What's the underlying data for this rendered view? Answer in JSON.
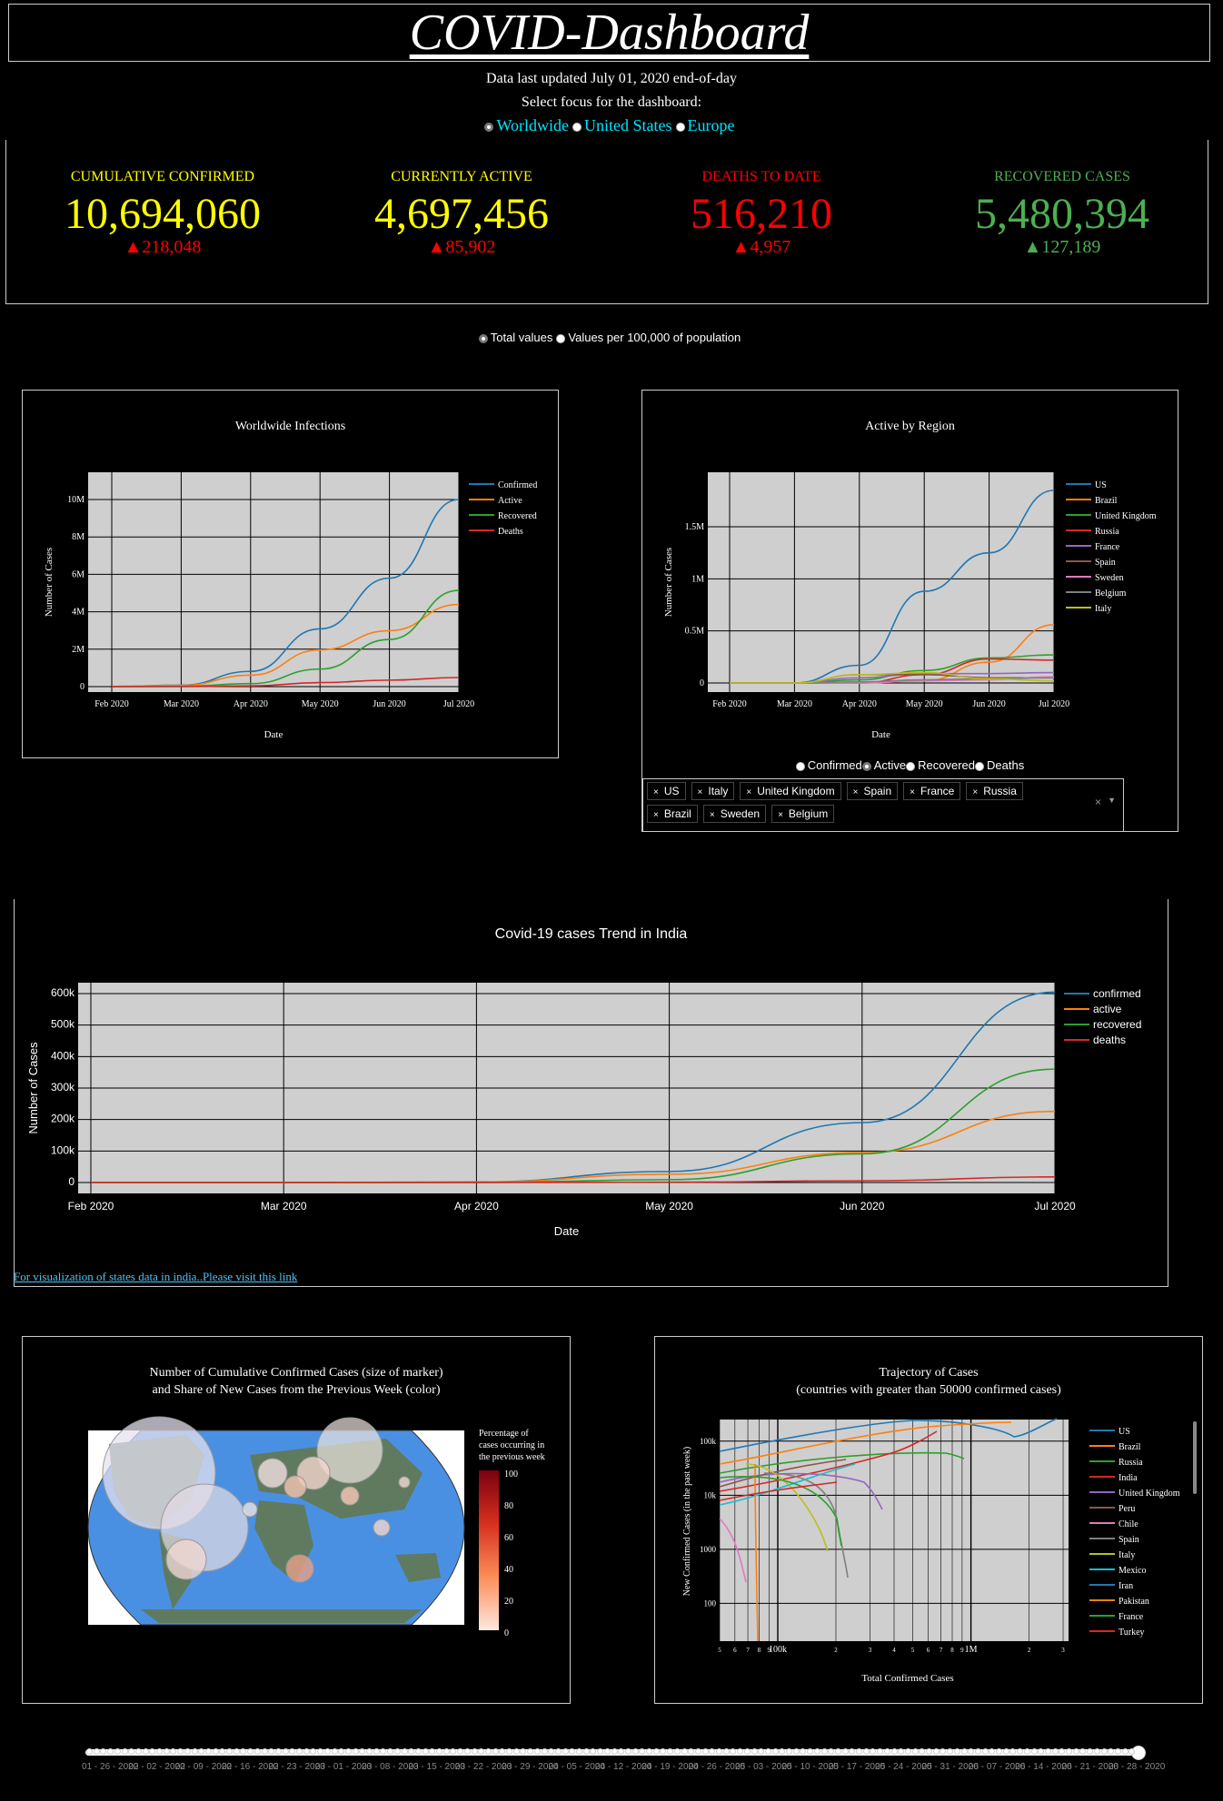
{
  "header": {
    "title": "COVID-Dashboard",
    "updated": "Data last updated July 01, 2020 end-of-day",
    "focus_prompt": "Select focus for the dashboard:"
  },
  "focus_options": [
    "Worldwide",
    "United States",
    "Europe"
  ],
  "focus_selected": "Worldwide",
  "kpis": [
    {
      "label": "CUMULATIVE CONFIRMED",
      "value": "10,694,060",
      "delta": "▲218,048",
      "color": "#ffff00",
      "delta_color": "#ff0000"
    },
    {
      "label": "CURRENTLY ACTIVE",
      "value": "4,697,456",
      "delta": "▲85,902",
      "color": "#ffff00",
      "delta_color": "#ff0000"
    },
    {
      "label": "DEATHS TO DATE",
      "value": "516,210",
      "delta": "▲4,957",
      "color": "#ff0000",
      "delta_color": "#ff0000"
    },
    {
      "label": "RECOVERED CASES",
      "value": "5,480,394",
      "delta": "▲127,189",
      "color": "#4caf50",
      "delta_color": "#4caf50"
    }
  ],
  "value_toggle": [
    "Total values",
    "Values per 100,000 of population"
  ],
  "chart_data": [
    {
      "type": "line",
      "title": "Worldwide Infections",
      "xlabel": "Date",
      "ylabel": "Number of Cases",
      "x_ticks": [
        "Feb 2020",
        "Mar 2020",
        "Apr 2020",
        "May 2020",
        "Jun 2020",
        "Jul 2020"
      ],
      "y_ticks": [
        "0",
        "2M",
        "4M",
        "6M",
        "8M",
        "10M"
      ],
      "ylim": [
        0,
        11000000
      ],
      "legend_position": "right",
      "series": [
        {
          "name": "Confirmed",
          "color": "#1f77b4",
          "values": [
            0.01,
            0.08,
            0.87,
            3.3,
            6.2,
            10.7
          ]
        },
        {
          "name": "Active",
          "color": "#ff7f0e",
          "values": [
            0.01,
            0.07,
            0.65,
            2.1,
            3.2,
            4.7
          ]
        },
        {
          "name": "Recovered",
          "color": "#2ca02c",
          "values": [
            0,
            0.02,
            0.17,
            1.0,
            2.7,
            5.5
          ]
        },
        {
          "name": "Deaths",
          "color": "#d62728",
          "values": [
            0,
            0,
            0.04,
            0.23,
            0.37,
            0.52
          ]
        }
      ]
    },
    {
      "type": "line",
      "title": "Active  by Region",
      "xlabel": "Date",
      "ylabel": "Number of Cases",
      "x_ticks": [
        "Feb 2020",
        "Mar 2020",
        "Apr 2020",
        "May 2020",
        "Jun 2020",
        "Jul 2020"
      ],
      "y_ticks": [
        "0",
        "0.5M",
        "1M",
        "1.5M"
      ],
      "ylim": [
        0,
        1900000
      ],
      "legend_position": "right",
      "series": [
        {
          "name": "US",
          "color": "#1f77b4",
          "values": [
            0,
            0,
            0.17,
            0.88,
            1.25,
            1.85
          ]
        },
        {
          "name": "Brazil",
          "color": "#ff7f0e",
          "values": [
            0,
            0,
            0,
            0.02,
            0.2,
            0.56
          ]
        },
        {
          "name": "United Kingdom",
          "color": "#2ca02c",
          "values": [
            0,
            0,
            0.03,
            0.12,
            0.24,
            0.27
          ]
        },
        {
          "name": "Russia",
          "color": "#d62728",
          "values": [
            0,
            0,
            0,
            0.08,
            0.23,
            0.22
          ]
        },
        {
          "name": "France",
          "color": "#9467bd",
          "values": [
            0,
            0,
            0.05,
            0.09,
            0.09,
            0.1
          ]
        },
        {
          "name": "Spain",
          "color": "#8c564b",
          "values": [
            0,
            0,
            0.08,
            0.08,
            0.05,
            0.05
          ]
        },
        {
          "name": "Sweden",
          "color": "#e377c2",
          "values": [
            0,
            0,
            0,
            0.02,
            0.03,
            0.06
          ]
        },
        {
          "name": "Belgium",
          "color": "#7f7f7f",
          "values": [
            0,
            0,
            0.01,
            0.03,
            0.04,
            0.05
          ]
        },
        {
          "name": "Italy",
          "color": "#bcbd22",
          "values": [
            0,
            0,
            0.08,
            0.1,
            0.04,
            0.02
          ]
        }
      ]
    },
    {
      "type": "line",
      "title": "Covid-19 cases Trend in India",
      "xlabel": "Date",
      "ylabel": "Number of Cases",
      "x_ticks": [
        "Feb 2020",
        "Mar 2020",
        "Apr 2020",
        "May 2020",
        "Jun 2020",
        "Jul 2020"
      ],
      "y_ticks": [
        "0",
        "100k",
        "200k",
        "300k",
        "400k",
        "500k",
        "600k"
      ],
      "ylim": [
        0,
        640000
      ],
      "legend_position": "right",
      "series": [
        {
          "name": "confirmed",
          "color": "#1f77b4",
          "values": [
            0,
            0,
            1500,
            35000,
            190000,
            605000
          ]
        },
        {
          "name": "active",
          "color": "#ff7f0e",
          "values": [
            0,
            0,
            1300,
            26000,
            95000,
            226000
          ]
        },
        {
          "name": "recovered",
          "color": "#2ca02c",
          "values": [
            0,
            0,
            100,
            9000,
            91000,
            360000
          ]
        },
        {
          "name": "deaths",
          "color": "#d62728",
          "values": [
            0,
            0,
            40,
            1100,
            5400,
            17800
          ]
        }
      ]
    }
  ],
  "region_metric_options": [
    "Confirmed",
    "Active",
    "Recovered",
    "Deaths"
  ],
  "region_metric_selected": "Active",
  "region_tags": [
    "US",
    "Italy",
    "United Kingdom",
    "Spain",
    "France",
    "Russia",
    "Brazil",
    "Sweden",
    "Belgium"
  ],
  "india_link": "For visualization of states data in india..Please visit this link",
  "map": {
    "title_line1": "Number of Cumulative Confirmed Cases (size of marker)",
    "title_line2": "and Share of New Cases from the Previous Week (color)",
    "colorbar_title": [
      "Percentage of",
      "cases occurring in",
      "the previous week"
    ],
    "colorbar_ticks": [
      "0",
      "20",
      "40",
      "60",
      "80",
      "100"
    ]
  },
  "trajectory": {
    "title_line1": "Trajectory of Cases",
    "title_line2": "(countries with greater than 50000 confirmed cases)",
    "xlabel": "Total Confirmed Cases",
    "ylabel": "New Confirmed Cases (in the past week)",
    "x_ticks": [
      "5",
      "6",
      "7",
      "8",
      "9",
      "100k",
      "2",
      "3",
      "4",
      "5",
      "6",
      "7",
      "8",
      "9",
      "1M",
      "2",
      "3"
    ],
    "y_ticks": [
      "100k",
      "10k",
      "1000",
      "100"
    ],
    "legend": [
      {
        "name": "US",
        "color": "#1f77b4"
      },
      {
        "name": "Brazil",
        "color": "#ff7f0e"
      },
      {
        "name": "Russia",
        "color": "#2ca02c"
      },
      {
        "name": "India",
        "color": "#d62728"
      },
      {
        "name": "United Kingdom",
        "color": "#9467bd"
      },
      {
        "name": "Peru",
        "color": "#8c564b"
      },
      {
        "name": "Chile",
        "color": "#e377c2"
      },
      {
        "name": "Spain",
        "color": "#7f7f7f"
      },
      {
        "name": "Italy",
        "color": "#bcbd22"
      },
      {
        "name": "Mexico",
        "color": "#17becf"
      },
      {
        "name": "Iran",
        "color": "#1f77b4"
      },
      {
        "name": "Pakistan",
        "color": "#ff7f0e"
      },
      {
        "name": "France",
        "color": "#2ca02c"
      },
      {
        "name": "Turkey",
        "color": "#d62728"
      }
    ]
  },
  "slider_labels": [
    "01 - 26 - 2020",
    "02 - 02 - 2020",
    "02 - 09 - 2020",
    "02 - 16 - 2020",
    "02 - 23 - 2020",
    "03 - 01 - 2020",
    "03 - 08 - 2020",
    "03 - 15 - 2020",
    "03 - 22 - 2020",
    "03 - 29 - 2020",
    "04 - 05 - 2020",
    "04 - 12 - 2020",
    "04 - 19 - 2020",
    "04 - 26 - 2020",
    "05 - 03 - 2020",
    "05 - 10 - 2020",
    "05 - 17 - 2020",
    "05 - 24 - 2020",
    "05 - 31 - 2020",
    "06 - 07 - 2020",
    "06 - 14 - 2020",
    "06 - 21 - 2020",
    "06 - 28 - 2020"
  ]
}
